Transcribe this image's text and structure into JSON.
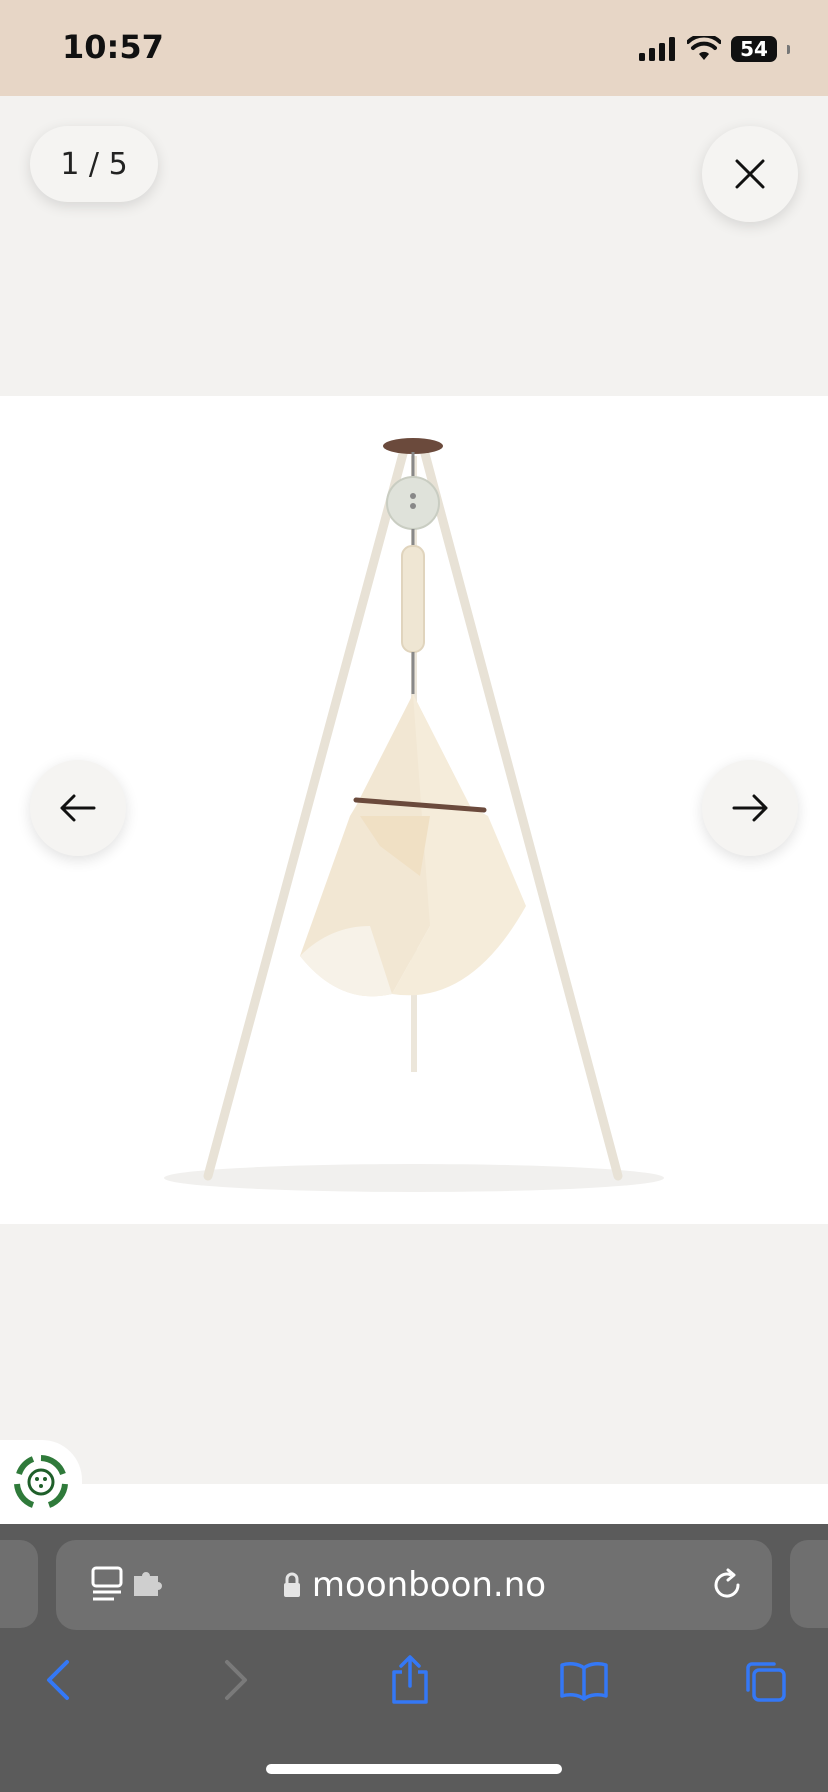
{
  "status_bar": {
    "time": "10:57",
    "battery_level": "54",
    "signal_icon": "cellular-signal-icon",
    "wifi_icon": "wifi-icon"
  },
  "gallery": {
    "counter": "1 / 5",
    "close_icon": "close-icon",
    "prev_icon": "arrow-left-icon",
    "next_icon": "arrow-right-icon",
    "image_alt": "Baby hammock hanging from a tripod stand",
    "eco_badge_icon": "eco-recycle-badge-icon"
  },
  "browser": {
    "url": "moonboon.no",
    "lock_icon": "lock-icon",
    "reader_icon": "reader-mode-icon",
    "extension_icon": "extension-puzzle-icon",
    "reload_icon": "reload-icon",
    "toolbar": [
      "back-icon",
      "forward-icon",
      "share-icon",
      "bookmarks-icon",
      "tabs-icon"
    ]
  },
  "colors": {
    "status_bar_bg": "#e7d6c6",
    "gallery_bg": "#f3f2f0",
    "browser_bg": "#5b5b5b",
    "toolbar_accent": "#3478f6",
    "eco_green": "#2f7a3a"
  }
}
